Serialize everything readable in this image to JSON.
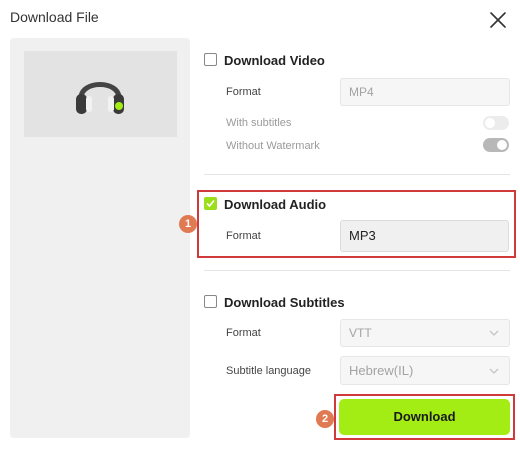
{
  "dialog": {
    "title": "Download File"
  },
  "icons": {
    "close": "close-icon",
    "headphones": "headphones-icon",
    "check": "check-icon",
    "chevron": "chevron-down-icon"
  },
  "video": {
    "label": "Download Video",
    "checked": false,
    "format_label": "Format",
    "format_value": "MP4",
    "subtitles_label": "With subtitles",
    "subtitles_on": false,
    "watermark_label": "Without Watermark",
    "watermark_on": true
  },
  "audio": {
    "label": "Download Audio",
    "checked": true,
    "format_label": "Format",
    "format_value": "MP3"
  },
  "subtitles": {
    "label": "Download Subtitles",
    "checked": false,
    "format_label": "Format",
    "format_value": "VTT",
    "language_label": "Subtitle language",
    "language_value": "Hebrew(IL)"
  },
  "annotations": {
    "step1": "1",
    "step2": "2"
  },
  "actions": {
    "download_label": "Download"
  },
  "colors": {
    "accent": "#a3ec14",
    "check": "#9bde1a",
    "highlight": "#d03a3a",
    "badge": "#e07a52"
  }
}
